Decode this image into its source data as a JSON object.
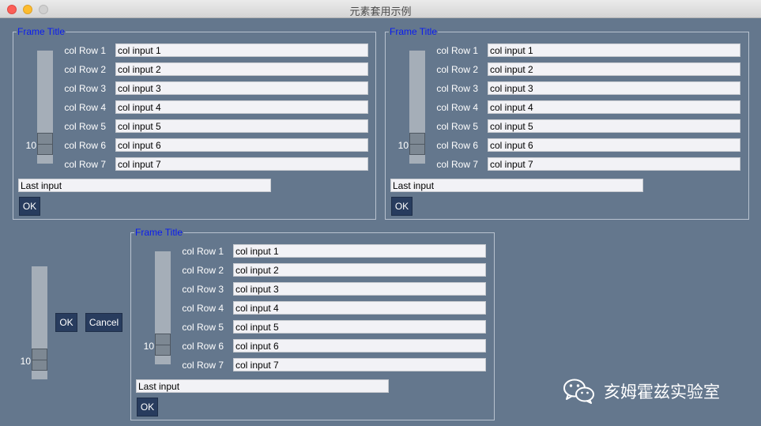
{
  "window": {
    "title": "元素套用示例"
  },
  "frames": [
    {
      "title": "Frame Title",
      "slider_value": "10",
      "rows": [
        {
          "label": "col Row 1",
          "value": "col input 1"
        },
        {
          "label": "col Row 2",
          "value": "col input 2"
        },
        {
          "label": "col Row 3",
          "value": "col input 3"
        },
        {
          "label": "col Row 4",
          "value": "col input 4"
        },
        {
          "label": "col Row 5",
          "value": "col input 5"
        },
        {
          "label": "col Row 6",
          "value": "col input 6"
        },
        {
          "label": "col Row 7",
          "value": "col input 7"
        }
      ],
      "last_input": "Last input",
      "ok_label": "OK"
    },
    {
      "title": "Frame Title",
      "slider_value": "10",
      "rows": [
        {
          "label": "col Row 1",
          "value": "col input 1"
        },
        {
          "label": "col Row 2",
          "value": "col input 2"
        },
        {
          "label": "col Row 3",
          "value": "col input 3"
        },
        {
          "label": "col Row 4",
          "value": "col input 4"
        },
        {
          "label": "col Row 5",
          "value": "col input 5"
        },
        {
          "label": "col Row 6",
          "value": "col input 6"
        },
        {
          "label": "col Row 7",
          "value": "col input 7"
        }
      ],
      "last_input": "Last input",
      "ok_label": "OK"
    },
    {
      "title": "Frame Title",
      "slider_value": "10",
      "rows": [
        {
          "label": "col Row 1",
          "value": "col input 1"
        },
        {
          "label": "col Row 2",
          "value": "col input 2"
        },
        {
          "label": "col Row 3",
          "value": "col input 3"
        },
        {
          "label": "col Row 4",
          "value": "col input 4"
        },
        {
          "label": "col Row 5",
          "value": "col input 5"
        },
        {
          "label": "col Row 6",
          "value": "col input 6"
        },
        {
          "label": "col Row 7",
          "value": "col input 7"
        }
      ],
      "last_input": "Last input",
      "ok_label": "OK"
    }
  ],
  "outer": {
    "slider_value": "10",
    "ok_label": "OK",
    "cancel_label": "Cancel"
  },
  "watermark": {
    "text": "亥姆霍兹实验室",
    "icon": "wechat-icon"
  },
  "colors": {
    "background": "#64778d",
    "frame_title": "#0a1cf0",
    "button": "#283c5e",
    "input": "#f2f2f6"
  }
}
